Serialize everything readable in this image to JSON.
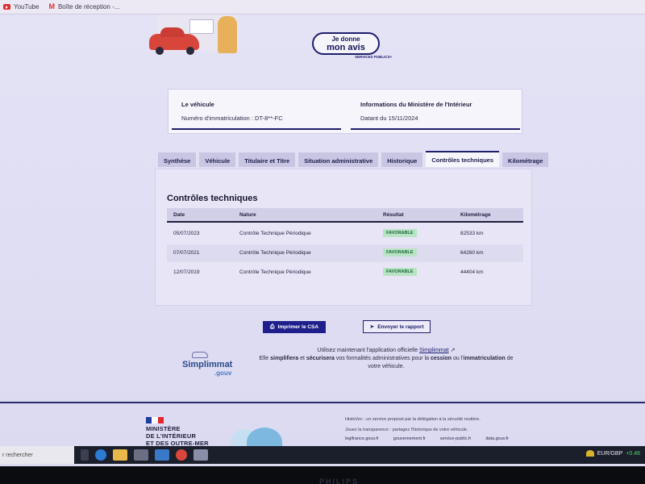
{
  "bookmarks": [
    {
      "label": "YouTube",
      "icon": "youtube-icon"
    },
    {
      "label": "Boîte de réception -...",
      "icon": "gmail-icon"
    }
  ],
  "header": {
    "feedback_line1": "Je donne",
    "feedback_line2": "mon avis",
    "services_publics": "SERVICES PUBLICS+"
  },
  "vehicle_card": {
    "title": "Le véhicule",
    "text": "Numéro d'immatriculation : DT-8**-FC"
  },
  "ministry_card": {
    "title": "Informations du Ministère de l'Intérieur",
    "text": "Datant du 15/11/2024"
  },
  "tabs": [
    {
      "label": "Synthèse",
      "active": false
    },
    {
      "label": "Véhicule",
      "active": false
    },
    {
      "label": "Titulaire et Titre",
      "active": false
    },
    {
      "label": "Situation administrative",
      "active": false
    },
    {
      "label": "Historique",
      "active": false
    },
    {
      "label": "Contrôles techniques",
      "active": true
    },
    {
      "label": "Kilométrage",
      "active": false
    }
  ],
  "panel": {
    "title": "Contrôles techniques",
    "columns": [
      "Date",
      "Nature",
      "Résultat",
      "Kilométrage"
    ],
    "rows": [
      {
        "date": "05/07/2023",
        "nature": "Contrôle Technique Périodique",
        "result": "FAVORABLE",
        "km": "82533 km"
      },
      {
        "date": "07/07/2021",
        "nature": "Contrôle Technique Périodique",
        "result": "FAVORABLE",
        "km": "64260 km"
      },
      {
        "date": "12/07/2019",
        "nature": "Contrôle Technique Périodique",
        "result": "FAVORABLE",
        "km": "44404 km"
      }
    ]
  },
  "actions": {
    "print_label": "Imprimer le CSA",
    "send_label": "Envoyer le rapport"
  },
  "promo": {
    "logo_word": "Simplimmat",
    "logo_suffix": ".gouv",
    "line1_prefix": "Utilisez maintenant l'application officielle ",
    "line1_link": "Simplimmat",
    "line2_a": "Elle ",
    "line2_b": "simplifiera",
    "line2_c": " et ",
    "line2_d": "sécurisera",
    "line2_e": " vos formalités administratives pour la ",
    "line2_f": "cession",
    "line2_g": " ou l'",
    "line2_h": "immatriculation",
    "line2_i": " de",
    "line3": "votre véhicule."
  },
  "footer": {
    "ministry_l1": "MINISTÈRE",
    "ministry_l2": "DE L'INTÉRIEUR",
    "ministry_l3": "ET DES OUTRE-MER",
    "text1": "HistoVec : un service proposé par la délégation à la sécurité routière.",
    "text2": "Jouez la transparence : partagez l'historique de votre véhicule.",
    "links": [
      "legifrance.gouv.fr",
      "gouvernement.fr",
      "service-public.fr",
      "data.gouv.fr"
    ]
  },
  "taskbar": {
    "search_placeholder": "r rechercher",
    "tray_label": "EUR/GBP",
    "tray_value": "+0.46"
  },
  "bezel_brand": "PHILIPS"
}
